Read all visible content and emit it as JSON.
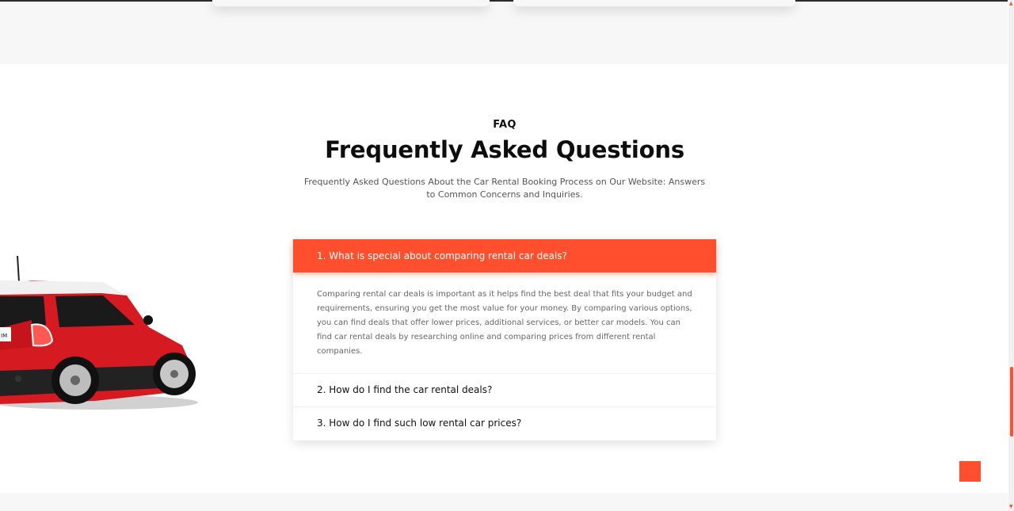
{
  "faq": {
    "eyebrow": "FAQ",
    "title": "Frequently Asked Questions",
    "subtitle": "Frequently Asked Questions About the Car Rental Booking Process on Our Website: Answers to Common Concerns and Inquiries."
  },
  "accordion": {
    "items": [
      {
        "question": "1. What is special about comparing rental car deals?",
        "answer": "Comparing rental car deals is important as it helps find the best deal that fits your budget and requirements, ensuring you get the most value for your money. By comparing various options, you can find deals that offer lower prices, additional services, or better car models. You can find car rental deals by researching online and comparing prices from different rental companies.",
        "expanded": true
      },
      {
        "question": "2. How do I find the car rental deals?",
        "expanded": false
      },
      {
        "question": "3. How do I find such low rental car prices?",
        "expanded": false
      }
    ]
  },
  "colors": {
    "accent": "#ff4f2e",
    "text": "#111111",
    "muted": "#666666",
    "band": "#f7f7f7"
  },
  "icons": {
    "scroll_top": "scroll-to-top-icon",
    "car_image": "red-hatchback-car"
  }
}
